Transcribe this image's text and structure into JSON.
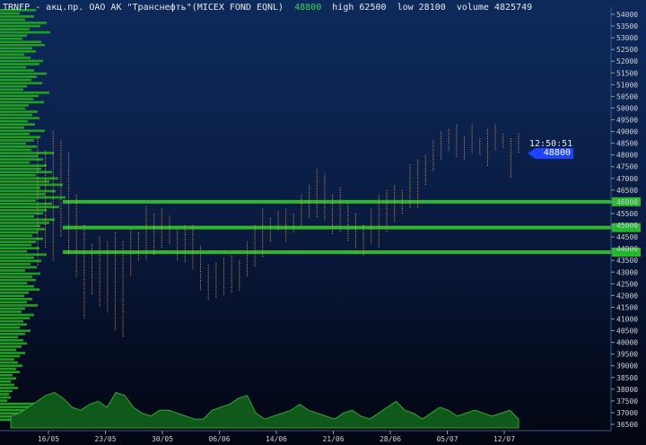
{
  "header": {
    "symbol": "TRNFP",
    "description": "акц.пр. ОАО АК \"Транснефть\"(MICEX FOND EQNL)",
    "last": "48800",
    "high_label": "high",
    "high": "62500",
    "low_label": "low",
    "low": "28100",
    "volume_label": "volume",
    "volume": "4825749"
  },
  "last_quote": {
    "time": "12:50:51",
    "price": "48800"
  },
  "colors": {
    "background_top": "#0d2a5c",
    "background_bottom": "#020611",
    "bars": "#f0a040",
    "volume_profile": "#1f9f1f",
    "level_lines": "#2fb52f",
    "volume_area": "#0f5a1a",
    "badge": "#1f44ff"
  },
  "chart_data": {
    "type": "bar",
    "title": "",
    "y_axis": {
      "min": 36500,
      "max": 54000,
      "ticks": [
        "54000",
        "53500",
        "53000",
        "52500",
        "52000",
        "51500",
        "51000",
        "50500",
        "50000",
        "49500",
        "49000",
        "48500",
        "48000",
        "47500",
        "47000",
        "46500",
        "46000",
        "45500",
        "45000",
        "44500",
        "44000",
        "43500",
        "43000",
        "42500",
        "42000",
        "41500",
        "41000",
        "40500",
        "40000",
        "39500",
        "39000",
        "38500",
        "38000",
        "37500",
        "37000",
        "36500"
      ]
    },
    "x_axis": {
      "date_labels": [
        "16/05",
        "23/05",
        "30/05",
        "06/06",
        "14/06",
        "21/06",
        "28/06",
        "05/07",
        "12/07"
      ]
    },
    "levels": [
      {
        "label": "46000",
        "value": 46000
      },
      {
        "label": "45000",
        "value": 44900
      },
      {
        "label": "43900",
        "value": 43850
      }
    ],
    "price_bars": [
      {
        "l": 43300,
        "h": 48700
      },
      {
        "l": 44000,
        "h": 48200
      },
      {
        "l": 43500,
        "h": 49000
      },
      {
        "l": 44500,
        "h": 48600
      },
      {
        "l": 43700,
        "h": 48100
      },
      {
        "l": 42800,
        "h": 46300
      },
      {
        "l": 41000,
        "h": 45000
      },
      {
        "l": 42000,
        "h": 44200
      },
      {
        "l": 41500,
        "h": 44500
      },
      {
        "l": 41300,
        "h": 44300
      },
      {
        "l": 40500,
        "h": 44700
      },
      {
        "l": 40200,
        "h": 44300
      },
      {
        "l": 42800,
        "h": 44800
      },
      {
        "l": 43500,
        "h": 44700
      },
      {
        "l": 43500,
        "h": 45800
      },
      {
        "l": 43700,
        "h": 45500
      },
      {
        "l": 44000,
        "h": 45700
      },
      {
        "l": 44200,
        "h": 45400
      },
      {
        "l": 43500,
        "h": 44800
      },
      {
        "l": 43400,
        "h": 45000
      },
      {
        "l": 43100,
        "h": 45000
      },
      {
        "l": 42200,
        "h": 44100
      },
      {
        "l": 41800,
        "h": 43300
      },
      {
        "l": 41900,
        "h": 43400
      },
      {
        "l": 42000,
        "h": 43600
      },
      {
        "l": 42100,
        "h": 43700
      },
      {
        "l": 42200,
        "h": 43500
      },
      {
        "l": 42800,
        "h": 44300
      },
      {
        "l": 43200,
        "h": 45000
      },
      {
        "l": 43600,
        "h": 45700
      },
      {
        "l": 44300,
        "h": 45300
      },
      {
        "l": 44800,
        "h": 45600
      },
      {
        "l": 44300,
        "h": 45700
      },
      {
        "l": 44700,
        "h": 45500
      },
      {
        "l": 45000,
        "h": 46300
      },
      {
        "l": 45300,
        "h": 46700
      },
      {
        "l": 45300,
        "h": 47400
      },
      {
        "l": 45200,
        "h": 47200
      },
      {
        "l": 44600,
        "h": 46300
      },
      {
        "l": 44700,
        "h": 46600
      },
      {
        "l": 44300,
        "h": 45900
      },
      {
        "l": 44000,
        "h": 45500
      },
      {
        "l": 43700,
        "h": 45000
      },
      {
        "l": 44200,
        "h": 45700
      },
      {
        "l": 44000,
        "h": 46300
      },
      {
        "l": 44700,
        "h": 46500
      },
      {
        "l": 45100,
        "h": 46700
      },
      {
        "l": 45500,
        "h": 46500
      },
      {
        "l": 45700,
        "h": 47600
      },
      {
        "l": 45700,
        "h": 47800
      },
      {
        "l": 46700,
        "h": 48000
      },
      {
        "l": 47300,
        "h": 48600
      },
      {
        "l": 47800,
        "h": 49000
      },
      {
        "l": 48200,
        "h": 49100
      },
      {
        "l": 47900,
        "h": 49300
      },
      {
        "l": 47800,
        "h": 48800
      },
      {
        "l": 48100,
        "h": 49300
      },
      {
        "l": 48000,
        "h": 48700
      },
      {
        "l": 47500,
        "h": 49100
      },
      {
        "l": 48200,
        "h": 49300
      },
      {
        "l": 48300,
        "h": 48900
      },
      {
        "l": 47000,
        "h": 48700
      },
      {
        "l": 48100,
        "h": 48900
      }
    ],
    "volume_series": [
      4,
      5,
      7,
      9,
      11,
      12,
      10,
      7,
      6,
      8,
      9,
      7,
      12,
      11,
      7,
      5,
      4,
      6,
      6,
      5,
      4,
      3,
      3,
      6,
      7,
      8,
      10,
      11,
      5,
      3,
      4,
      5,
      6,
      8,
      6,
      5,
      4,
      3,
      5,
      6,
      4,
      3,
      5,
      7,
      9,
      6,
      5,
      3,
      5,
      7,
      6,
      4,
      5,
      6,
      5,
      4,
      5,
      6,
      3
    ],
    "volume_profile": [
      40,
      22,
      38,
      28,
      52,
      45,
      33,
      56,
      30,
      25,
      46,
      50,
      36,
      40,
      27,
      34,
      48,
      44,
      29,
      38,
      52,
      41,
      35,
      47,
      30,
      26,
      55,
      43,
      37,
      49,
      32,
      28,
      42,
      36,
      44,
      31,
      39,
      27,
      50,
      33,
      45,
      38,
      29,
      41,
      35,
      60,
      42,
      48,
      33,
      52,
      46,
      58,
      40,
      65,
      55,
      70,
      45,
      62,
      50,
      73,
      40,
      58,
      66,
      52,
      48,
      38,
      61,
      55,
      45,
      50,
      42,
      36,
      48,
      40,
      35,
      44,
      30,
      52,
      38,
      46,
      34,
      41,
      28,
      45,
      36,
      40,
      30,
      38,
      44,
      32,
      27,
      36,
      30,
      42,
      28,
      24,
      38,
      33,
      26,
      30,
      22,
      34,
      28,
      20,
      26,
      30,
      24,
      18,
      28,
      22,
      16,
      20,
      25,
      18,
      22,
      14,
      18,
      12,
      16,
      20,
      14,
      10,
      12,
      8,
      45,
      60,
      38,
      30,
      20,
      15
    ]
  }
}
